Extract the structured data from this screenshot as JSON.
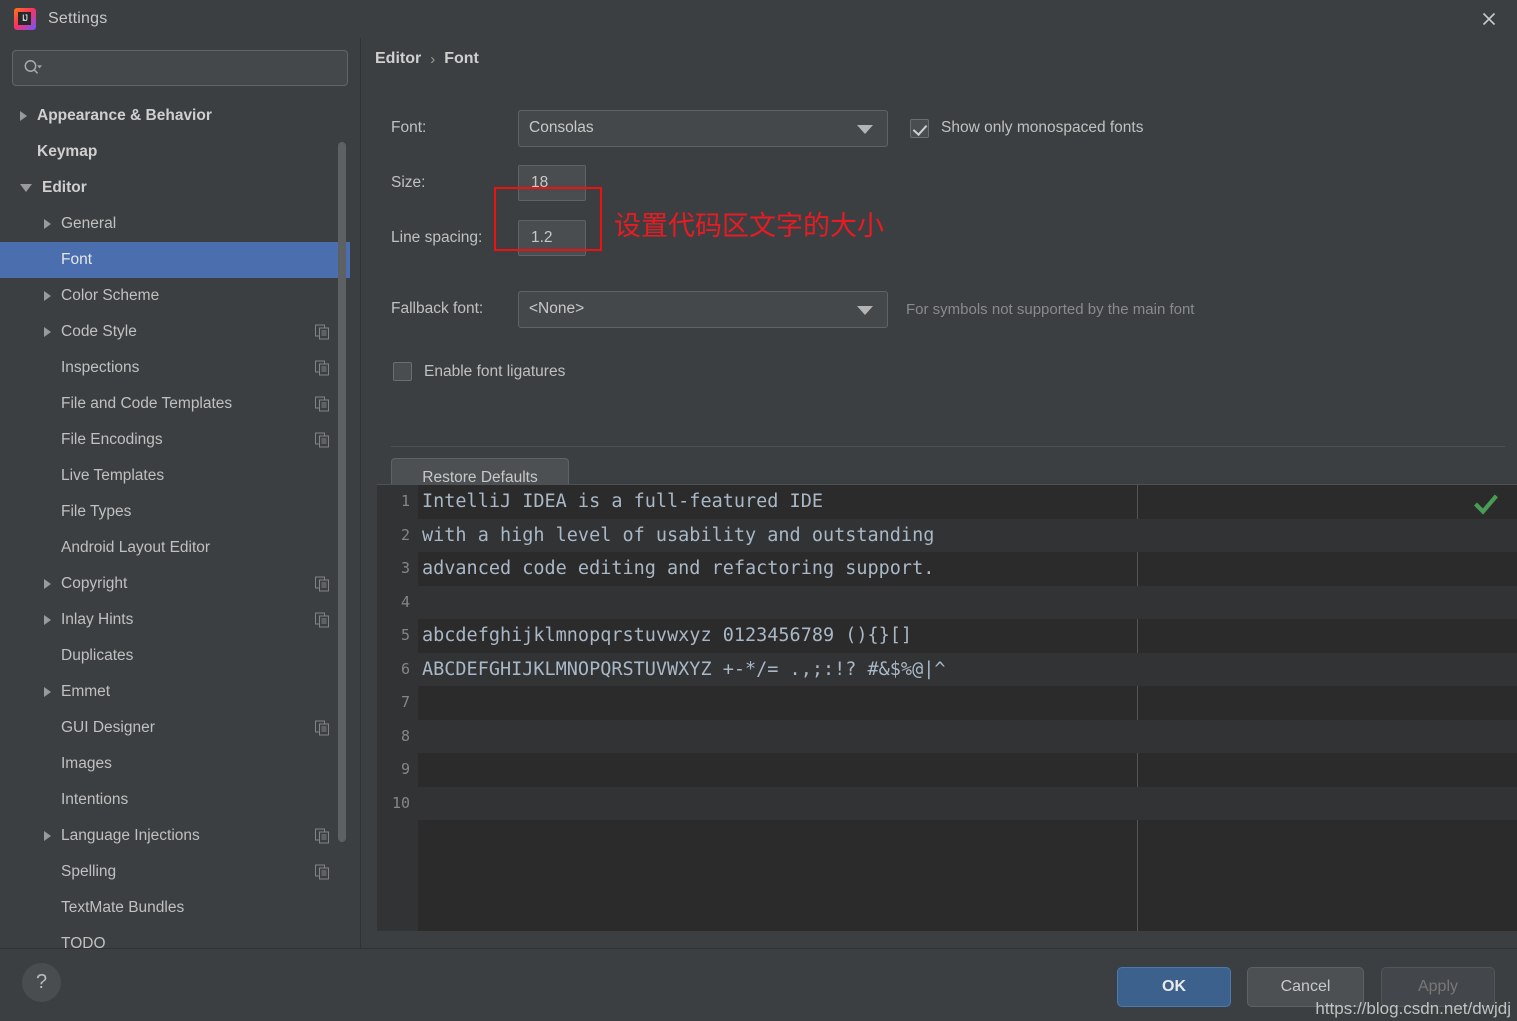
{
  "window": {
    "title": "Settings",
    "app_icon": "intellij-idea-icon",
    "close_label": "×"
  },
  "search": {
    "placeholder": "",
    "value": "",
    "icon": "search-icon"
  },
  "sidebar": {
    "items": [
      {
        "label": "Appearance & Behavior",
        "level": 0,
        "arrow": "right",
        "selected": false,
        "badge": false
      },
      {
        "label": "Keymap",
        "level": 0,
        "arrow": "none",
        "selected": false,
        "badge": false
      },
      {
        "label": "Editor",
        "level": 0,
        "arrow": "down",
        "selected": false,
        "badge": false
      },
      {
        "label": "General",
        "level": 1,
        "arrow": "right",
        "selected": false,
        "badge": false
      },
      {
        "label": "Font",
        "level": 1,
        "arrow": "none",
        "selected": true,
        "badge": false
      },
      {
        "label": "Color Scheme",
        "level": 1,
        "arrow": "right",
        "selected": false,
        "badge": false
      },
      {
        "label": "Code Style",
        "level": 1,
        "arrow": "right",
        "selected": false,
        "badge": true
      },
      {
        "label": "Inspections",
        "level": 1,
        "arrow": "none",
        "selected": false,
        "badge": true
      },
      {
        "label": "File and Code Templates",
        "level": 1,
        "arrow": "none",
        "selected": false,
        "badge": true
      },
      {
        "label": "File Encodings",
        "level": 1,
        "arrow": "none",
        "selected": false,
        "badge": true
      },
      {
        "label": "Live Templates",
        "level": 1,
        "arrow": "none",
        "selected": false,
        "badge": false
      },
      {
        "label": "File Types",
        "level": 1,
        "arrow": "none",
        "selected": false,
        "badge": false
      },
      {
        "label": "Android Layout Editor",
        "level": 1,
        "arrow": "none",
        "selected": false,
        "badge": false
      },
      {
        "label": "Copyright",
        "level": 1,
        "arrow": "right",
        "selected": false,
        "badge": true
      },
      {
        "label": "Inlay Hints",
        "level": 1,
        "arrow": "right",
        "selected": false,
        "badge": true
      },
      {
        "label": "Duplicates",
        "level": 1,
        "arrow": "none",
        "selected": false,
        "badge": false
      },
      {
        "label": "Emmet",
        "level": 1,
        "arrow": "right",
        "selected": false,
        "badge": false
      },
      {
        "label": "GUI Designer",
        "level": 1,
        "arrow": "none",
        "selected": false,
        "badge": true
      },
      {
        "label": "Images",
        "level": 1,
        "arrow": "none",
        "selected": false,
        "badge": false
      },
      {
        "label": "Intentions",
        "level": 1,
        "arrow": "none",
        "selected": false,
        "badge": false
      },
      {
        "label": "Language Injections",
        "level": 1,
        "arrow": "right",
        "selected": false,
        "badge": true
      },
      {
        "label": "Spelling",
        "level": 1,
        "arrow": "none",
        "selected": false,
        "badge": true
      },
      {
        "label": "TextMate Bundles",
        "level": 1,
        "arrow": "none",
        "selected": false,
        "badge": false
      },
      {
        "label": "TODO",
        "level": 1,
        "arrow": "none",
        "selected": false,
        "badge": false
      }
    ]
  },
  "breadcrumb": {
    "parent": "Editor",
    "separator": "›",
    "current": "Font"
  },
  "form": {
    "font_label": "Font:",
    "font_value": "Consolas",
    "show_monospaced_label": "Show only monospaced fonts",
    "show_monospaced_checked": true,
    "size_label": "Size:",
    "size_value": "18",
    "size_annotation": "设置代码区文字的大小",
    "line_spacing_label": "Line spacing:",
    "line_spacing_value": "1.2",
    "fallback_label": "Fallback font:",
    "fallback_value": "<None>",
    "fallback_hint": "For symbols not supported by the main font",
    "ligatures_label": "Enable font ligatures",
    "ligatures_checked": false,
    "restore_defaults_label": "Restore Defaults"
  },
  "preview": {
    "lines": [
      {
        "number": "1",
        "text": "IntelliJ IDEA is a full-featured IDE"
      },
      {
        "number": "2",
        "text": "with a high level of usability and outstanding"
      },
      {
        "number": "3",
        "text": "advanced code editing and refactoring support."
      },
      {
        "number": "4",
        "text": ""
      },
      {
        "number": "5",
        "text": "abcdefghijklmnopqrstuvwxyz 0123456789 (){}[]"
      },
      {
        "number": "6",
        "text": "ABCDEFGHIJKLMNOPQRSTUVWXYZ +-*/= .,;:!? #&$%@|^"
      },
      {
        "number": "7",
        "text": ""
      },
      {
        "number": "8",
        "text": ""
      },
      {
        "number": "9",
        "text": ""
      },
      {
        "number": "10",
        "text": ""
      }
    ],
    "inspection_icon": "green-check-icon"
  },
  "footer": {
    "help_label": "?",
    "ok_label": "OK",
    "cancel_label": "Cancel",
    "apply_label": "Apply",
    "watermark": "https://blog.csdn.net/dwjdj"
  },
  "colors": {
    "accent_selection": "#4b6eaf",
    "ok_button": "#3c618c",
    "annotation_red": "#e81b23",
    "background": "#3c3f41",
    "editor_background": "#2b2b2b",
    "code_text": "#a9b7c6",
    "inspection_green": "#499c54"
  }
}
